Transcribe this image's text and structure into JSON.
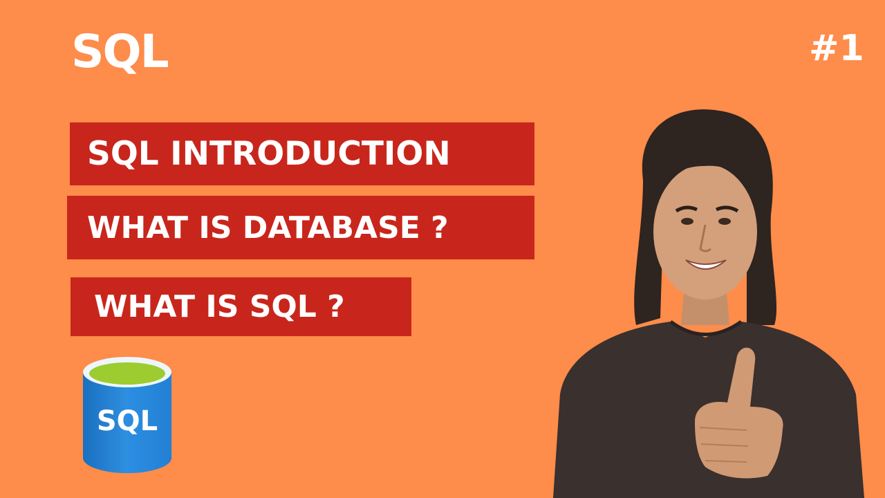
{
  "header": {
    "logo_text": "SQL",
    "episode_badge": "#1"
  },
  "banners": [
    {
      "label": "SQL INTRODUCTION"
    },
    {
      "label": "WHAT IS DATABASE ?"
    },
    {
      "label": "WHAT IS SQL ?"
    }
  ],
  "database_icon": {
    "label": "SQL",
    "icon": "database-cylinder-icon"
  },
  "presenter": {
    "icon": "presenter-thumbs-up-photo"
  },
  "colors": {
    "background": "#fe8c4a",
    "banner_red": "#c8261c",
    "text_white": "#ffffff",
    "db_blue": "#1f82d0",
    "db_lime": "#9ccc2f"
  }
}
